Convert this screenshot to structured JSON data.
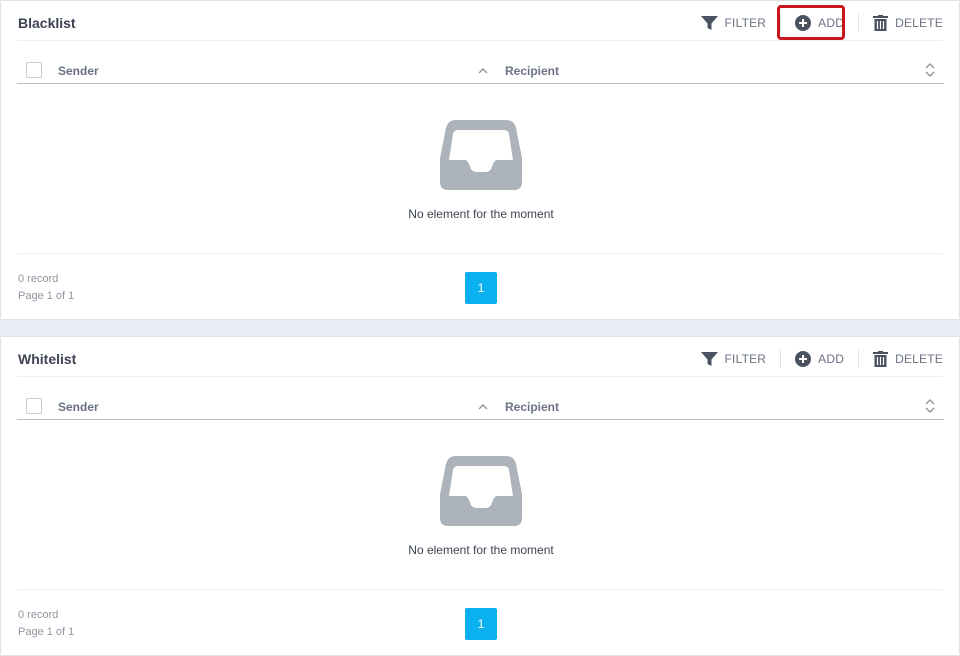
{
  "blacklist": {
    "title": "Blacklist",
    "toolbar": {
      "filter_label": "FILTER",
      "add_label": "ADD",
      "delete_label": "DELETE"
    },
    "columns": {
      "sender": "Sender",
      "recipient": "Recipient"
    },
    "empty_message": "No element for the moment",
    "records_text": "0 record",
    "pages_text": "Page 1 of 1",
    "current_page": "1"
  },
  "whitelist": {
    "title": "Whitelist",
    "toolbar": {
      "filter_label": "FILTER",
      "add_label": "ADD",
      "delete_label": "DELETE"
    },
    "columns": {
      "sender": "Sender",
      "recipient": "Recipient"
    },
    "empty_message": "No element for the moment",
    "records_text": "0 record",
    "pages_text": "Page 1 of 1",
    "current_page": "1"
  },
  "icons": [
    "filter-icon",
    "add-circle-icon",
    "trash-icon",
    "sort-asc-icon",
    "sort-icon",
    "inbox-empty-icon"
  ],
  "colors": {
    "accent": "#0ab0f0",
    "icon": "#4a5261",
    "highlight": "#c8161d",
    "empty_icon": "#adb3ba"
  }
}
